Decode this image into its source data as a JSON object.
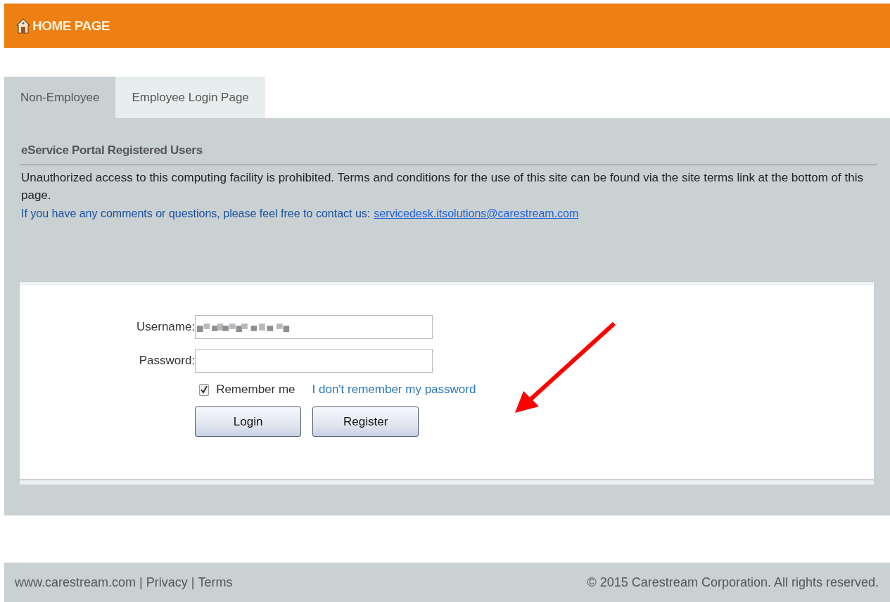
{
  "header": {
    "title": "HOME PAGE"
  },
  "tabs": [
    {
      "label": "Non-Employee",
      "selected": true
    },
    {
      "label": "Employee Login Page",
      "selected": false
    }
  ],
  "panel": {
    "heading": "eService Portal Registered Users",
    "notice": "Unauthorized access to this computing facility is prohibited. Terms and conditions for the use of this site can be found via the site terms link at the bottom of this page.",
    "contact_text": "If you have any comments or questions, please feel free to contact us:",
    "contact_link": "servicedesk.itsolutions@carestream.com"
  },
  "login_form": {
    "username": {
      "label": "Username:",
      "redacted": true
    },
    "password": {
      "label": "Password:"
    },
    "remember_me": {
      "label": "Remember me",
      "checked": true
    },
    "forgot_link": "I don't remember my password",
    "buttons": [
      "Login",
      "Register"
    ]
  },
  "annotations": [
    {
      "kind": "arrow",
      "color": "#ff0000"
    }
  ],
  "footer": {
    "links": [
      "www.carestream.com",
      "Privacy",
      "Terms"
    ],
    "separator": "|",
    "copyright": "© 2015 Carestream Corporation. All rights reserved."
  }
}
